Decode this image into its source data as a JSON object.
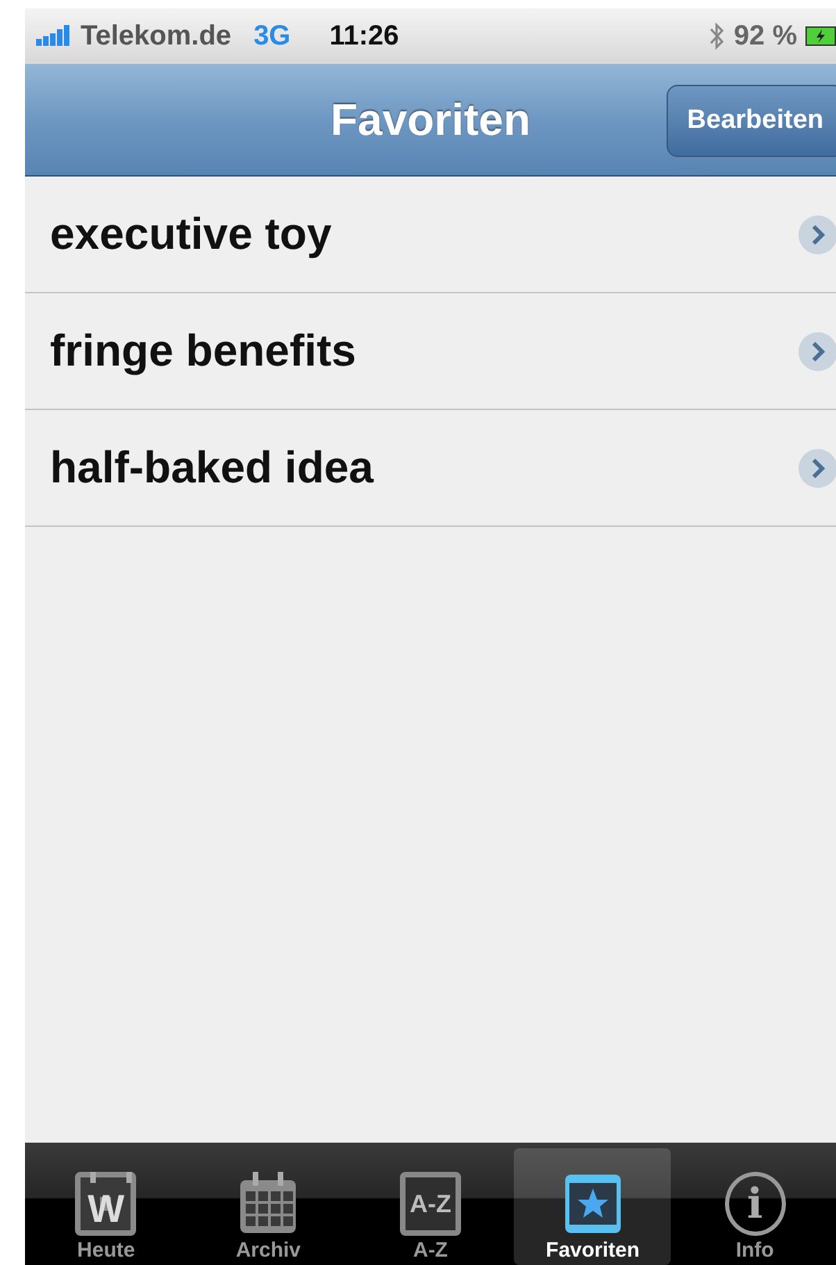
{
  "status_bar": {
    "carrier": "Telekom.de",
    "network": "3G",
    "time": "11:26",
    "battery": "92 %"
  },
  "nav_bar": {
    "title": "Favoriten",
    "button": "Bearbeiten"
  },
  "list": [
    {
      "label": "executive toy"
    },
    {
      "label": "fringe benefits"
    },
    {
      "label": "half-baked idea"
    }
  ],
  "tab_bar": [
    {
      "label": "Heute",
      "kind": "calendar",
      "glyph": "W",
      "selected": false
    },
    {
      "label": "Archiv",
      "kind": "grid",
      "selected": false
    },
    {
      "label": "A-Z",
      "kind": "letters",
      "glyph": "A-Z",
      "selected": false
    },
    {
      "label": "Favoriten",
      "kind": "star",
      "selected": true
    },
    {
      "label": "Info",
      "kind": "info",
      "glyph": "i",
      "selected": false
    }
  ]
}
